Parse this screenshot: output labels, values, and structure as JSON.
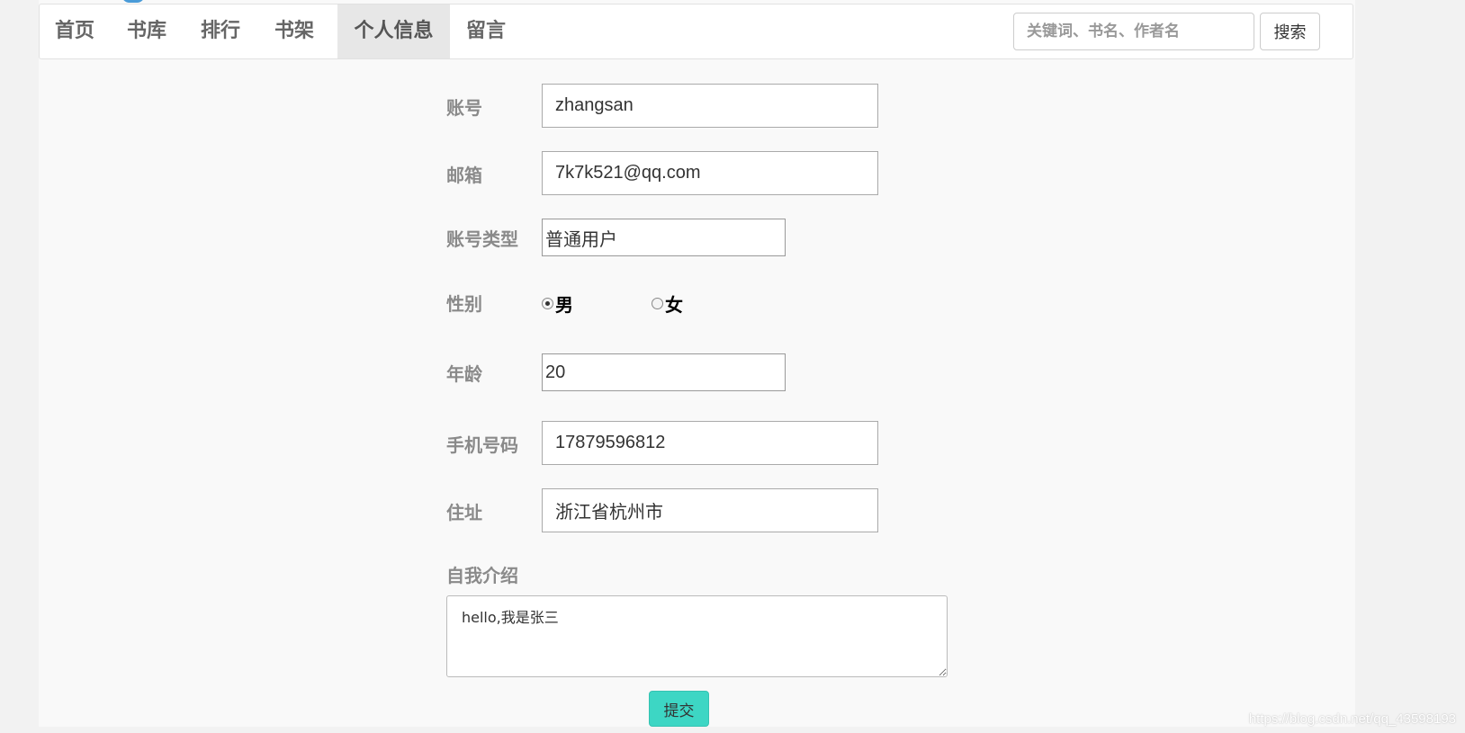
{
  "nav": {
    "items": [
      {
        "label": "首页"
      },
      {
        "label": "书库"
      },
      {
        "label": "排行"
      },
      {
        "label": "书架"
      },
      {
        "label": "个人信息",
        "active": true
      },
      {
        "label": "留言"
      }
    ],
    "search_placeholder": "关键词、书名、作者名",
    "search_button": "搜索"
  },
  "form": {
    "account_label": "账号",
    "account_value": "zhangsan",
    "email_label": "邮箱",
    "email_value": "7k7k521@qq.com",
    "account_type_label": "账号类型",
    "account_type_value": "普通用户",
    "gender_label": "性别",
    "gender_options": [
      "男",
      "女"
    ],
    "gender_selected": "男",
    "age_label": "年龄",
    "age_value": "20",
    "phone_label": "手机号码",
    "phone_value": "17879596812",
    "address_label": "住址",
    "address_value": "浙江省杭州市",
    "intro_label": "自我介绍",
    "intro_value": "hello,我是张三",
    "submit_label": "提交"
  },
  "watermark": "https://blog.csdn.net/qq_43598193",
  "colors": {
    "submit_button": "#3dd6c4",
    "active_nav": "#e7e7e7"
  }
}
